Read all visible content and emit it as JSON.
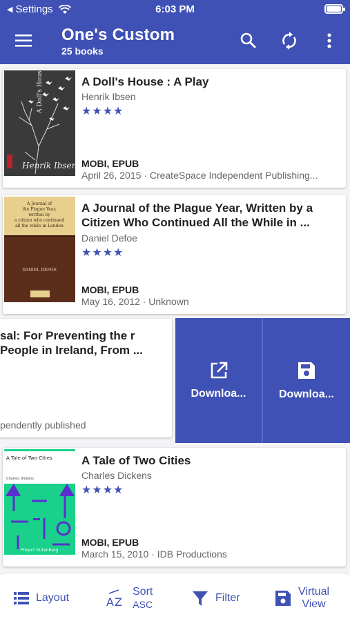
{
  "status": {
    "back_app": "Settings",
    "time": "6:03 PM"
  },
  "appbar": {
    "title": "One's Custom",
    "subtitle": "25 books"
  },
  "books": [
    {
      "title": "A Doll's House : A Play",
      "author": "Henrik Ibsen",
      "stars": "★★★★",
      "formats": "MOBI, EPUB",
      "meta": "April 26, 2015 · CreateSpace Independent Publishing..."
    },
    {
      "title": "A Journal of the Plague Year, Written by a Citizen Who Continued All the While in ...",
      "author": "Daniel Defoe",
      "stars": "★★★★",
      "formats": "MOBI, EPUB",
      "meta": "May 16, 2012 · Unknown"
    },
    {
      "title_partial": "sal: For Preventing the r People in Ireland, From ...",
      "meta_partial": "pendently published"
    },
    {
      "title": "A Tale of Two Cities",
      "author": "Charles Dickens",
      "stars": "★★★★",
      "formats": "MOBI, EPUB",
      "meta": "March 15, 2010 · IDB Productions"
    }
  ],
  "covers": {
    "dolls_house_title": "A Doll's House : a play",
    "dolls_house_author": "Henrik Ibsen",
    "plague_title": "A Journal of the Plague Year, written by a citizen who continued all the while in London",
    "plague_author": "DANIEL DEFOE",
    "tale_title": "A Tale of Two Cities",
    "tale_author": "Charles Dickens",
    "tale_publisher": "Project Gutenberg"
  },
  "swipe_actions": {
    "open_external": "Downloa...",
    "download": "Downloa..."
  },
  "bottom_bar": {
    "layout": "Layout",
    "sort": "Sort",
    "sort_dir": "ASC",
    "filter": "Filter",
    "virtual_1": "Virtual",
    "virtual_2": "View"
  },
  "colors": {
    "primary": "#3f51b5",
    "tale_green": "#19d18a"
  }
}
